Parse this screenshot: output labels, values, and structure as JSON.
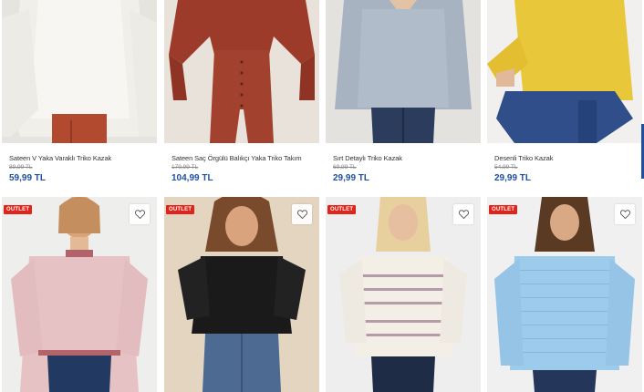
{
  "products_row1": [
    {
      "name": "Sateen V Yaka Varaklı Triko Kazak",
      "old_price": "89,99 TL",
      "price": "59,99 TL"
    },
    {
      "name": "Sateen Saç Örgülü Balıkçı Yaka Triko Takım",
      "old_price": "179,99 TL",
      "price": "104,99 TL"
    },
    {
      "name": "Sırt Detaylı Triko Kazak",
      "old_price": "69,99 TL",
      "price": "29,99 TL"
    },
    {
      "name": "Desenli Triko Kazak",
      "old_price": "54,99 TL",
      "price": "29,99 TL"
    }
  ],
  "products_row2": [
    {
      "badge": "OUTLET",
      "image": "pink sweater with contrast trim"
    },
    {
      "badge": "OUTLET",
      "image": "black top with tied sleeves"
    },
    {
      "badge": "OUTLET",
      "image": "cream striped knit sweater"
    },
    {
      "badge": "OUTLET",
      "image": "light blue knit sweater"
    }
  ],
  "colors": {
    "price": "#1e4fa0",
    "badge": "#e2231a"
  }
}
